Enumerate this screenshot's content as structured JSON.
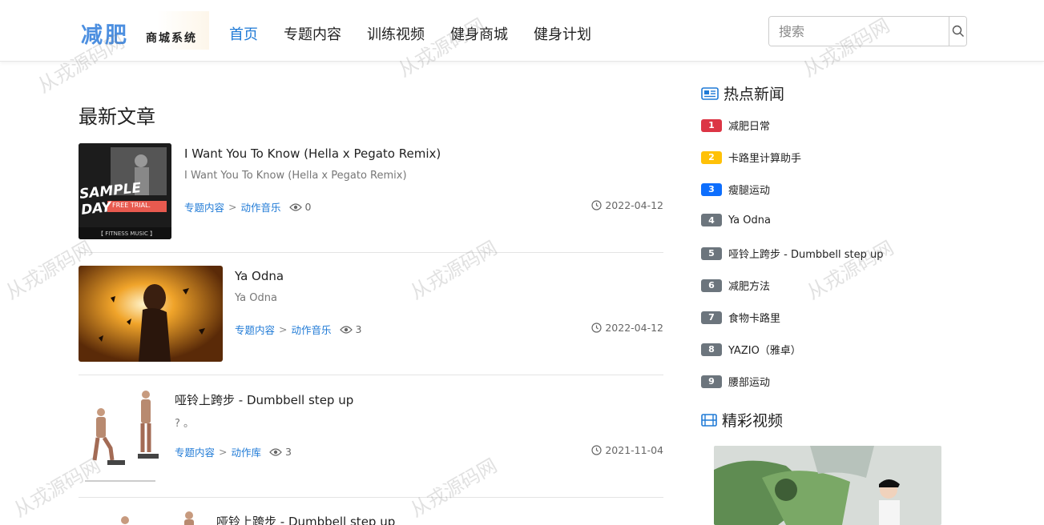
{
  "header": {
    "logo_main": "减肥",
    "logo_sub": "商城系统",
    "nav": [
      "首页",
      "专题内容",
      "训练视频",
      "健身商城",
      "健身计划"
    ],
    "search_placeholder": "搜索"
  },
  "main": {
    "title": "最新文章",
    "articles": [
      {
        "title": "I Want You To Know (Hella x Pegato Remix)",
        "desc": "I Want You To Know (Hella x Pegato Remix)",
        "cat1": "专题内容",
        "cat2": "动作音乐",
        "views": "0",
        "date": "2022-04-12",
        "thumb_text": "SAMPLE DAY",
        "thumb_sub": "FREE TRIAL.",
        "thumb_foot": "【 FITNESS MUSIC 】"
      },
      {
        "title": "Ya Odna",
        "desc": "Ya Odna",
        "cat1": "专题内容",
        "cat2": "动作音乐",
        "views": "3",
        "date": "2022-04-12"
      },
      {
        "title": "哑铃上跨步 - Dumbbell step up",
        "desc": "? 。",
        "cat1": "专题内容",
        "cat2": "动作库",
        "views": "3",
        "date": "2021-11-04"
      },
      {
        "title": "哑铃上跨步 - Dumbbell step up"
      }
    ],
    "sep": ">"
  },
  "sidebar": {
    "hot_title": "热点新闻",
    "hot": [
      {
        "rank": "1",
        "label": "减肥日常",
        "color": "#dc3545"
      },
      {
        "rank": "2",
        "label": "卡路里计算助手",
        "color": "#ffc107"
      },
      {
        "rank": "3",
        "label": "瘦腿运动",
        "color": "#0d6efd"
      },
      {
        "rank": "4",
        "label": "Ya Odna",
        "color": "#6c757d"
      },
      {
        "rank": "5",
        "label": "哑铃上跨步 - Dumbbell step up",
        "color": "#6c757d"
      },
      {
        "rank": "6",
        "label": "减肥方法",
        "color": "#6c757d"
      },
      {
        "rank": "7",
        "label": "食物卡路里",
        "color": "#6c757d"
      },
      {
        "rank": "8",
        "label": "YAZIO（雅卓）",
        "color": "#6c757d"
      },
      {
        "rank": "9",
        "label": "腰部运动",
        "color": "#6c757d"
      }
    ],
    "video_title": "精彩视频"
  },
  "watermark": "从戎源码网",
  "colors": {
    "accent": "#1f7ad6"
  }
}
